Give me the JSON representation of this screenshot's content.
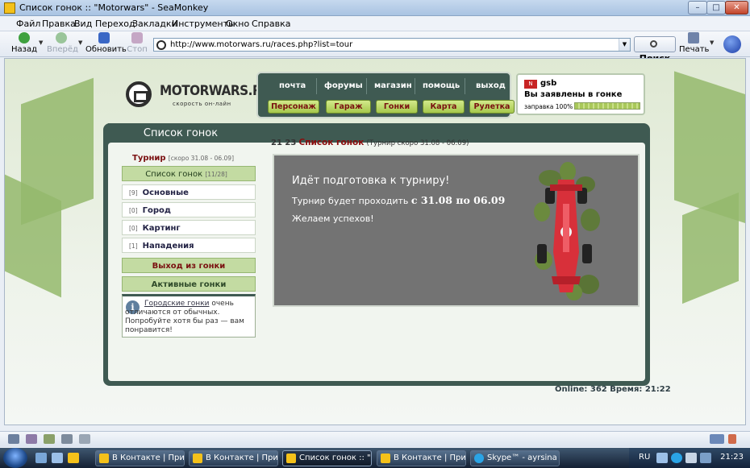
{
  "window": {
    "title": "Список гонок :: \"Motorwars\" - SeaMonkey",
    "min_label": "–",
    "max_label": "□",
    "close_label": "✕"
  },
  "menu": [
    "Файл",
    "Правка",
    "Вид",
    "Переход",
    "Закладки",
    "Инструменты",
    "Окно",
    "Справка"
  ],
  "toolbar": {
    "back": "Назад",
    "forward": "Вперёд",
    "reload": "Обновить",
    "stop": "Стоп",
    "search": "Поиск",
    "print": "Печать"
  },
  "address": {
    "url": "http://www.motorwars.ru/races.php?list=tour"
  },
  "site": {
    "logo_name": "MOTORWARS.RU",
    "logo_tagline": "скорость он-лайн",
    "top_nav": [
      "почта",
      "форумы",
      "магазин",
      "помощь",
      "выход"
    ],
    "green_nav": [
      "Персонаж",
      "Гараж",
      "Гонки",
      "Карта",
      "Рулетка"
    ],
    "user": {
      "flag": "N",
      "name": "gsb",
      "status": "Вы заявлены в гонке",
      "fuel_label": "заправка 100%",
      "fuel_percent": 100
    },
    "sidebar": {
      "title": "Список гонок",
      "tour_title": "Турнир",
      "tour_dates": "[скоро 31.08 - 06.09]",
      "list_title": "Список гонок",
      "list_count": "[11/28]",
      "categories": [
        {
          "count": "[9]",
          "label": "Основные"
        },
        {
          "count": "[0]",
          "label": "Город"
        },
        {
          "count": "[0]",
          "label": "Картинг"
        },
        {
          "count": "[1]",
          "label": "Нападения"
        }
      ],
      "exit_race": "Выход из гонки",
      "active_races": "Активные гонки",
      "info_link": "Городские гонки",
      "info_text": " очень отличаются от обычных. Попробуйте хотя бы раз — вам понравится!"
    },
    "content": {
      "time": "21 23",
      "title": "Список гонок",
      "subtitle": "(Турнир скоро 31.08 - 06.09)",
      "line1": "Идёт подготовка к турниру!",
      "line2_prefix": "Турнир будет проходить ",
      "line2_dates": "с 31.08 по 06.09",
      "line3": "Желаем успехов!"
    },
    "online_text": "Online: 362  Время: 21:22"
  },
  "taskbar": {
    "tasks": [
      "В Контакте | Прило...",
      "В Контакте | Прило...",
      "Список гонок :: \"M...",
      "В Контакте | Прило...",
      "Skype™ - ayrsina"
    ],
    "lang": "RU",
    "clock": "21:23"
  },
  "colors": {
    "panel": "#3f5a52",
    "accent_red": "#8a0d0d",
    "green_button": "#a6c84c"
  }
}
